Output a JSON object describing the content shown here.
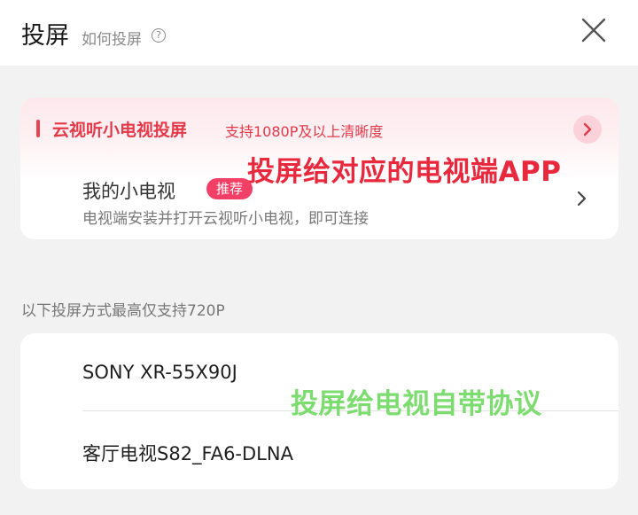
{
  "header": {
    "title": "投屏",
    "howto_label": "如何投屏",
    "help_icon_glyph": "?",
    "close_icon": "close-icon"
  },
  "cloud_tv": {
    "title": "云视听小电视投屏",
    "subtitle": "支持1080P及以上清晰度",
    "annotation": "投屏给对应的电视端APP",
    "item": {
      "name": "我的小电视",
      "badge": "推荐",
      "description": "电视端安装并打开云视听小电视，即可连接"
    },
    "accent_color": "#e23a4a"
  },
  "section_label": "以下投屏方式最高仅支持720P",
  "devices": {
    "items": [
      {
        "name": "SONY XR-55X90J"
      },
      {
        "name": "客厅电视S82_FA6-DLNA"
      }
    ],
    "annotation": "投屏给电视自带协议",
    "annotation_color": "#7ddc6f"
  }
}
